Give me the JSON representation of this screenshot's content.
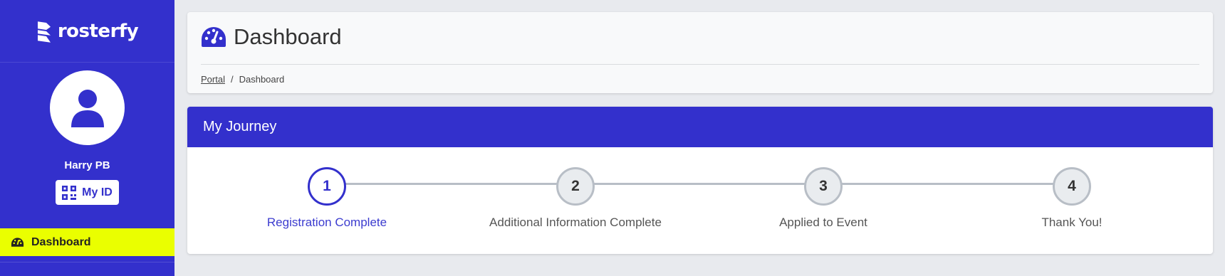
{
  "brand": {
    "name": "rosterfy"
  },
  "user": {
    "name": "Harry PB",
    "myid_label": "My ID"
  },
  "nav": {
    "items": [
      {
        "label": "Dashboard",
        "active": true
      }
    ]
  },
  "header": {
    "title": "Dashboard",
    "breadcrumb": [
      {
        "label": "Portal",
        "link": true
      },
      {
        "label": "Dashboard",
        "link": false
      }
    ],
    "breadcrumb_separator": "/"
  },
  "journey": {
    "title": "My Journey",
    "steps": [
      {
        "number": "1",
        "label": "Registration Complete",
        "active": true
      },
      {
        "number": "2",
        "label": "Additional Information Complete",
        "active": false
      },
      {
        "number": "3",
        "label": "Applied to Event",
        "active": false
      },
      {
        "number": "4",
        "label": "Thank You!",
        "active": false
      }
    ]
  },
  "colors": {
    "primary": "#3330cc",
    "nav_active": "#eaff00",
    "step_inactive_border": "#b8bec6",
    "step_inactive_fill": "#e9ecef",
    "background": "#e8eaee"
  },
  "icons": {
    "brand": "rosterfy-logo-icon",
    "avatar": "user-icon",
    "myid": "qr-code-icon",
    "nav_dashboard": "tachometer-icon",
    "title": "tachometer-icon"
  }
}
